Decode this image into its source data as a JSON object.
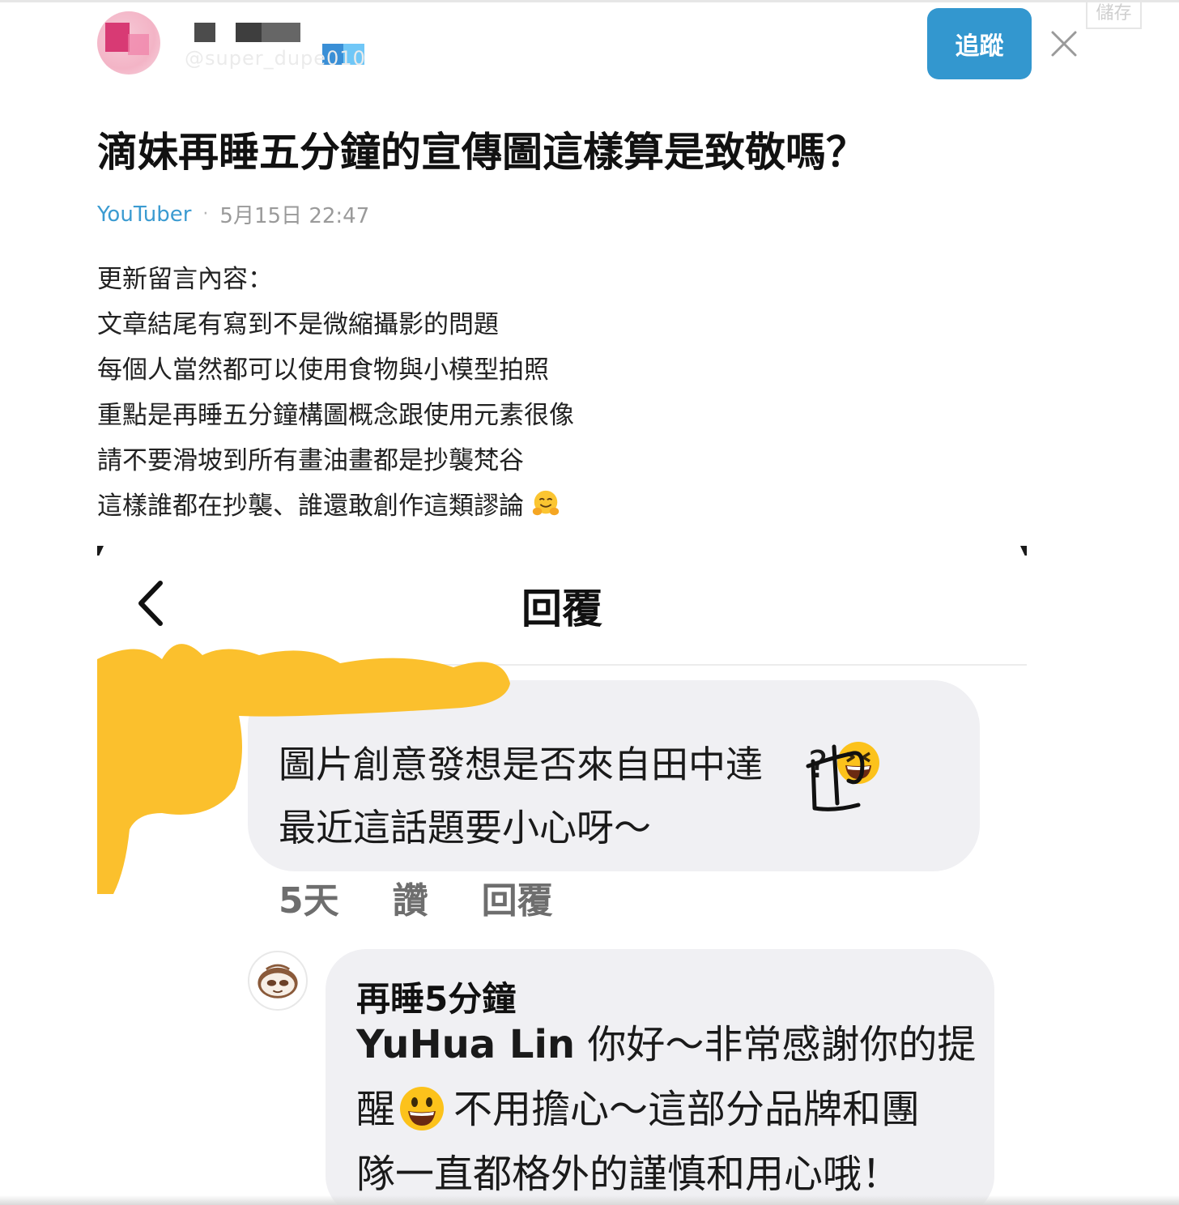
{
  "header": {
    "author_handle": "@super_dupe010",
    "follow_label": "追蹤",
    "save_label": "儲存"
  },
  "post": {
    "title": "滴妹再睡五分鐘的宣傳圖這樣算是致敬嗎？",
    "board": "YouTuber",
    "separator": "·",
    "timestamp": "5月15日 22:47",
    "body_lines": [
      "更新留言內容：",
      "文章結尾有寫到不是微縮攝影的問題",
      "每個人當然都可以使用食物與小模型拍照",
      "重點是再睡五分鐘構圖概念跟使用元素很像",
      "請不要滑坡到所有畫油畫都是抄襲梵谷",
      "這樣誰都在抄襲、誰還敢創作這類謬論"
    ]
  },
  "embedded": {
    "title": "回覆",
    "comment": {
      "line1": "圖片創意發想是否來自田中達",
      "line1_end": "?",
      "line2": "最近這話題要小心呀～",
      "handwriting": "也"
    },
    "actions": {
      "time": "5天",
      "like": "讚",
      "reply": "回覆"
    },
    "reply": {
      "name": "再睡5分鐘",
      "line1_latin": "YuHua Lin",
      "line1_rest": " 你好～非常感謝你的提",
      "line2_start": "醒",
      "line2_rest": "不用擔心～這部分品牌和團",
      "line3": "隊一直都格外的謹慎和用心哦！"
    }
  },
  "icons": [
    "close-icon",
    "back-chevron-icon",
    "hugging-face-emoji",
    "grinning-squinting-emoji",
    "smiling-face-emoji"
  ],
  "colors": {
    "accent": "#3397cf",
    "board_link": "#3b9bd1",
    "highlight": "#fbc02d"
  }
}
